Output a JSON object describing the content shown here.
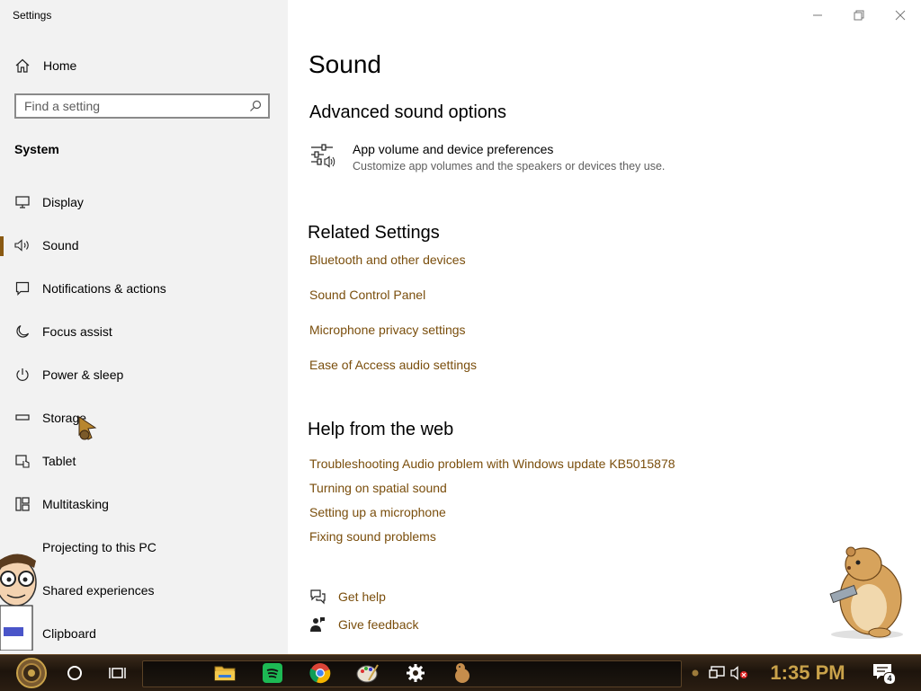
{
  "window": {
    "title": "Settings"
  },
  "sidebar": {
    "home_label": "Home",
    "search_placeholder": "Find a setting",
    "section_label": "System",
    "items": [
      {
        "label": "Display",
        "icon": "display-icon"
      },
      {
        "label": "Sound",
        "icon": "speaker-icon",
        "active": true
      },
      {
        "label": "Notifications & actions",
        "icon": "notifications-icon"
      },
      {
        "label": "Focus assist",
        "icon": "moon-icon"
      },
      {
        "label": "Power & sleep",
        "icon": "power-icon"
      },
      {
        "label": "Storage",
        "icon": "storage-icon"
      },
      {
        "label": "Tablet",
        "icon": "tablet-icon"
      },
      {
        "label": "Multitasking",
        "icon": "multitasking-icon"
      },
      {
        "label": "Projecting to this PC",
        "icon": "projecting-icon"
      },
      {
        "label": "Shared experiences",
        "icon": "shared-icon"
      },
      {
        "label": "Clipboard",
        "icon": "clipboard-icon"
      }
    ]
  },
  "main": {
    "title": "Sound",
    "advanced": {
      "heading": "Advanced sound options",
      "option_title": "App volume and device preferences",
      "option_desc": "Customize app volumes and the speakers or devices they use."
    },
    "related": {
      "heading": "Related Settings",
      "links": [
        "Bluetooth and other devices",
        "Sound Control Panel",
        "Microphone privacy settings",
        "Ease of Access audio settings"
      ]
    },
    "help_web": {
      "heading": "Help from the web",
      "links": [
        "Troubleshooting Audio problem with Windows update KB5015878",
        "Turning on spatial sound",
        "Setting up a microphone",
        "Fixing sound problems"
      ]
    },
    "get_help": "Get help",
    "give_feedback": "Give feedback"
  },
  "taskbar": {
    "time": "1:35 PM",
    "notification_count": "4"
  },
  "colors": {
    "accent": "#7a4e0c",
    "sidebar_bg": "#f2f2f2",
    "active_indicator": "#8a5a12",
    "clock": "#c9a24a"
  }
}
